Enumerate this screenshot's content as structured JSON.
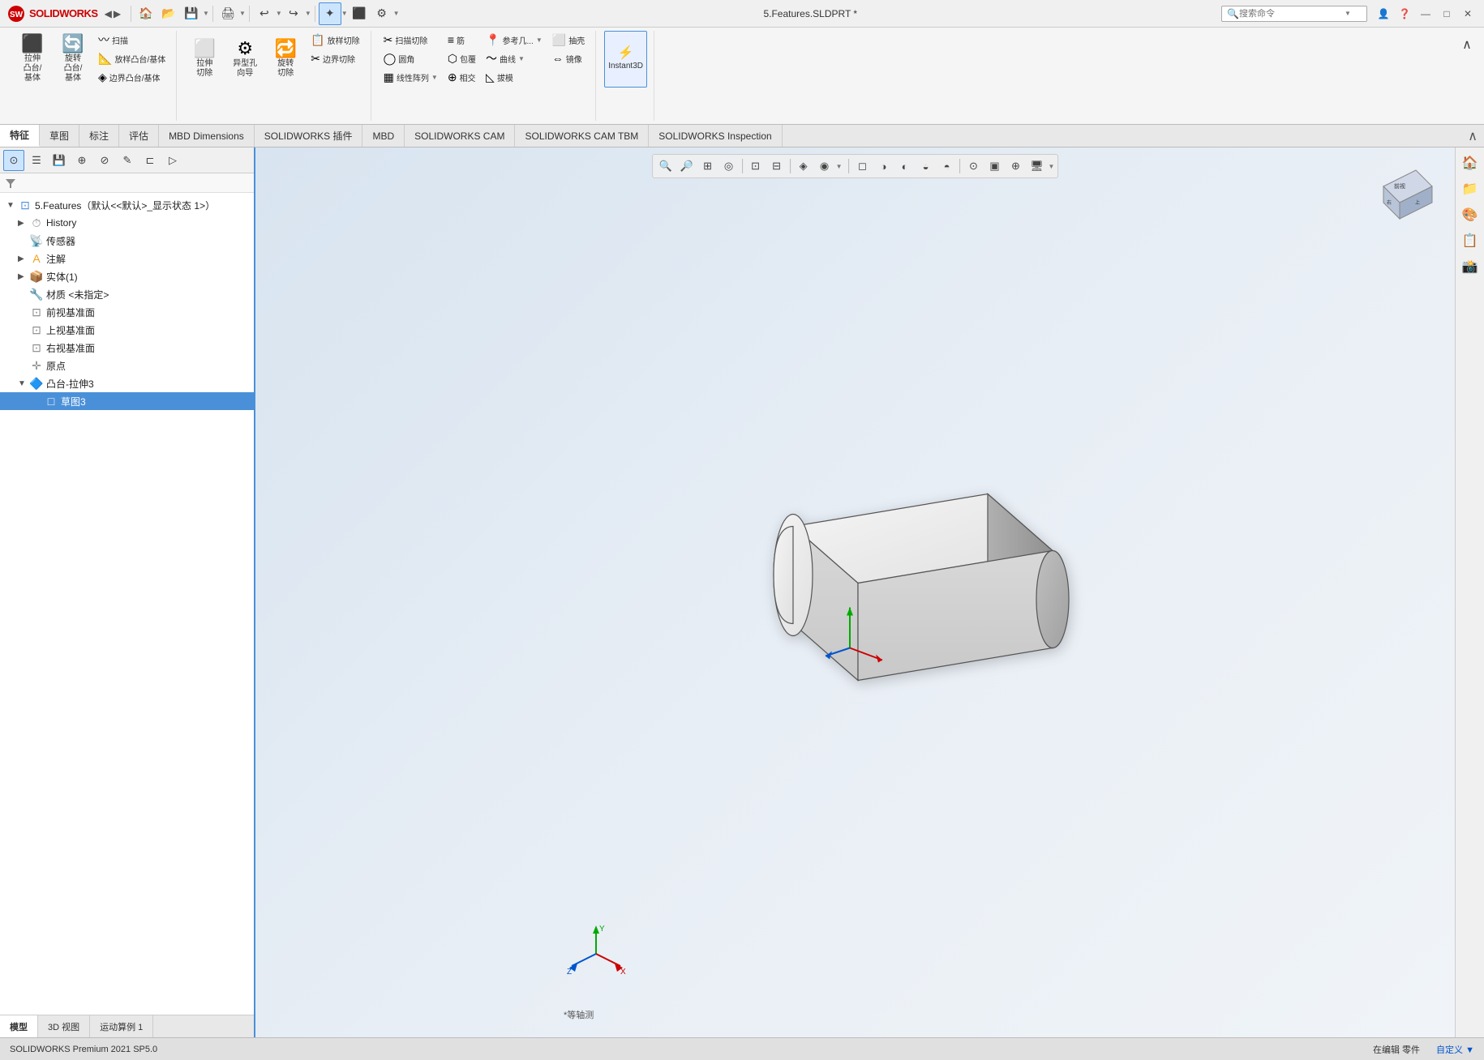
{
  "titlebar": {
    "filename": "5.Features.SLDPRT *",
    "search_placeholder": "搜索命令"
  },
  "ribbon": {
    "groups": [
      {
        "buttons": [
          {
            "label": "拉伸\n凸台/\n基体",
            "icon": "⬛"
          },
          {
            "label": "旋转\n凸台/\n基体",
            "icon": "🔄"
          },
          {
            "label": "扫描",
            "icon": "〰"
          },
          {
            "label": "放样凸台/基体",
            "icon": "📐"
          },
          {
            "label": "边界凸台/基体",
            "icon": "◈"
          }
        ]
      },
      {
        "buttons": [
          {
            "label": "拉伸\n切除",
            "icon": "⬜"
          },
          {
            "label": "异型孔\n向导",
            "icon": "⚙"
          },
          {
            "label": "旋转\n切除",
            "icon": "🔁"
          },
          {
            "label": "放样\n切除",
            "icon": "📋"
          },
          {
            "label": "边界切除",
            "icon": "✂"
          }
        ]
      },
      {
        "small_buttons": [
          {
            "label": "扫描切除",
            "icon": "✂"
          },
          {
            "label": "圆角",
            "icon": "◯"
          },
          {
            "label": "线性\n阵列",
            "icon": "▦"
          },
          {
            "label": "筋",
            "icon": "≡"
          },
          {
            "label": "包覆",
            "icon": "⬡"
          },
          {
            "label": "参考\n几...",
            "icon": "📍"
          },
          {
            "label": "曲线",
            "icon": "〜"
          }
        ]
      }
    ],
    "instant3d": "Instant3D",
    "small_buttons": [
      {
        "label": "拔模",
        "icon": "◺"
      },
      {
        "label": "抽壳",
        "icon": "⬜"
      },
      {
        "label": "相交",
        "icon": "⊕"
      },
      {
        "label": "镜像",
        "icon": "⇔"
      }
    ]
  },
  "tabs": {
    "items": [
      "特征",
      "草图",
      "标注",
      "评估",
      "MBD Dimensions",
      "SOLIDWORKS 插件",
      "MBD",
      "SOLIDWORKS CAM",
      "SOLIDWORKS CAM TBM",
      "SOLIDWORKS Inspection"
    ],
    "active": "特征"
  },
  "feature_tree": {
    "title": "5.Features（默认<<默认>_显示状态 1>）",
    "items": [
      {
        "level": 0,
        "toggle": "▶",
        "icon": "⏱",
        "name": "History",
        "selected": false
      },
      {
        "level": 0,
        "toggle": "",
        "icon": "📡",
        "name": "传感器",
        "selected": false
      },
      {
        "level": 0,
        "toggle": "▶",
        "icon": "📝",
        "name": "注解",
        "selected": false
      },
      {
        "level": 0,
        "toggle": "▶",
        "icon": "📦",
        "name": "实体(1)",
        "selected": false
      },
      {
        "level": 0,
        "toggle": "",
        "icon": "🔧",
        "name": "材质 <未指定>",
        "selected": false
      },
      {
        "level": 0,
        "toggle": "",
        "icon": "⊡",
        "name": "前视基准面",
        "selected": false
      },
      {
        "level": 0,
        "toggle": "",
        "icon": "⊡",
        "name": "上视基准面",
        "selected": false
      },
      {
        "level": 0,
        "toggle": "",
        "icon": "⊡",
        "name": "右视基准面",
        "selected": false
      },
      {
        "level": 0,
        "toggle": "",
        "icon": "✛",
        "name": "原点",
        "selected": false
      },
      {
        "level": 0,
        "toggle": "▼",
        "icon": "🔷",
        "name": "凸台-拉伸3",
        "selected": false
      },
      {
        "level": 1,
        "toggle": "",
        "icon": "📄",
        "name": "草图3",
        "selected": true
      }
    ]
  },
  "panel_tools": [
    "⊙",
    "☰",
    "💾",
    "⊕",
    "⊘",
    "✎",
    "⊏",
    "▷"
  ],
  "viewport": {
    "view_label": "*等轴测",
    "toolbar_buttons": [
      "🔍",
      "🔎",
      "⊞",
      "◎",
      "🖊",
      "⊡",
      "⊟",
      "◈",
      "◉",
      "◻",
      "◑",
      "◐",
      "◒",
      "◓",
      "⊙",
      "▣"
    ]
  },
  "bottom_tabs": [
    "模型",
    "3D 视图",
    "运动算例 1"
  ],
  "status_bar": {
    "left": "SOLIDWORKS Premium 2021 SP5.0",
    "middle": "在编辑 零件",
    "right": "自定义 ▼"
  },
  "right_sidebar_buttons": [
    "🏠",
    "📁",
    "🔧",
    "🎨",
    "📋"
  ]
}
